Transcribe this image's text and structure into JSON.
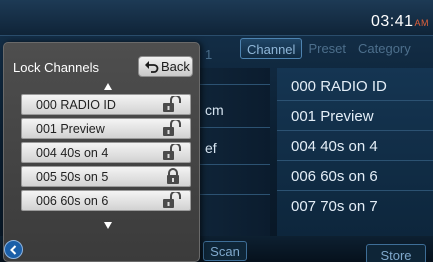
{
  "status": {
    "time": "03:41",
    "ampm": "AM"
  },
  "tabs": [
    {
      "label": "Channel",
      "active": true
    },
    {
      "label": "Preset",
      "active": false
    },
    {
      "label": "Category",
      "active": false
    }
  ],
  "background": {
    "row_hint": "1",
    "middle_rows": [
      "cm",
      "ef"
    ],
    "channel_list": [
      "000 RADIO ID",
      "001 Preview",
      "004 40s on 4",
      "006 60s on 6",
      "007 70s on 7"
    ],
    "scan_label": "Scan",
    "store_label": "Store"
  },
  "popup": {
    "title": "Lock Channels",
    "back_label": "Back",
    "items": [
      {
        "label": "000 RADIO ID",
        "locked": false
      },
      {
        "label": "001 Preview",
        "locked": false
      },
      {
        "label": "004 40s on 4",
        "locked": false
      },
      {
        "label": "005 50s on 5",
        "locked": true
      },
      {
        "label": "006 60s on 6",
        "locked": false
      }
    ]
  },
  "icons": {
    "back": "back-arrow-icon",
    "unlocked": "padlock-open-icon",
    "locked": "padlock-closed-icon",
    "scroll_up": "triangle-up-icon",
    "scroll_down": "triangle-down-icon",
    "nav_back": "circle-chevron-left-icon"
  },
  "colors": {
    "accent": "#1b5fa8",
    "ampm": "#e0603a"
  }
}
